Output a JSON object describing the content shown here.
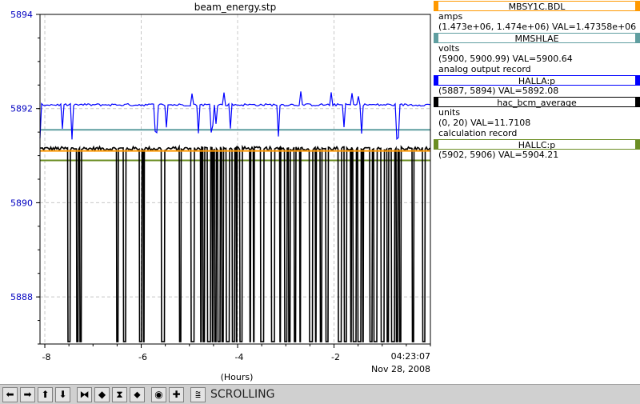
{
  "chart_data": {
    "type": "line",
    "title": "beam_energy.stp",
    "xlabel": "(Hours)",
    "x_ticks": [
      "-8",
      "-6",
      "-4",
      "-2"
    ],
    "y_ticks": [
      "5894",
      "5892",
      "5890",
      "5888"
    ],
    "end_time": "04:23:07",
    "end_date": "Nov 28, 2008",
    "xlim": [
      -8.1,
      0
    ],
    "ylim": [
      5887,
      5894
    ],
    "grid": true,
    "series": [
      {
        "name": "MBSY1C.BDL",
        "color": "#ff9900",
        "shape": "flat",
        "value": 5891.1
      },
      {
        "name": "MMSHLAE",
        "color": "#5f9ea0",
        "shape": "flat",
        "value": 5891.55
      },
      {
        "name": "HALLA:p",
        "color": "#0000ff",
        "shape": "noisy_with_downward_spikes",
        "value": 5892.08
      },
      {
        "name": "hac_bcm_average",
        "color": "#000000",
        "shape": "frequent_drops_to_bottom",
        "value": 5891.15
      },
      {
        "name": "HALLC:p",
        "color": "#6b8e23",
        "shape": "flat",
        "value": 5890.9
      }
    ]
  },
  "legend": [
    {
      "name": "MBSY1C.BDL",
      "color": "#ff9900",
      "lines": [
        "amps",
        "(1.473e+06, 1.474e+06)  VAL=1.47358e+06"
      ]
    },
    {
      "name": "MMSHLAE",
      "color": "#5f9ea0",
      "lines": [
        "volts",
        "(5900, 5900.99)  VAL=5900.64",
        "analog output record"
      ]
    },
    {
      "name": "HALLA:p",
      "color": "#0000ff",
      "lines": [
        "(5887, 5894) VAL=5892.08"
      ]
    },
    {
      "name": "hac_bcm_average",
      "color": "#000000",
      "lines": [
        "units",
        "(0, 20) VAL=11.7108",
        "calculation record"
      ]
    },
    {
      "name": "HALLC:p",
      "color": "#6b8e23",
      "lines": [
        "(5902, 5906)  VAL=5904.21"
      ]
    }
  ],
  "toolbar": {
    "buttons": [
      {
        "name": "scroll-left-button",
        "icon": "arrow-left-icon",
        "glyph": "⬅"
      },
      {
        "name": "scroll-right-button",
        "icon": "arrow-right-icon",
        "glyph": "➡"
      },
      {
        "name": "scroll-up-button",
        "icon": "arrow-up-icon",
        "glyph": "⬆"
      },
      {
        "name": "scroll-down-button",
        "icon": "arrow-down-icon",
        "glyph": "⬇"
      },
      {
        "name": "zoom-in-x-button",
        "icon": "zoom-in-x-icon",
        "glyph": "⧓"
      },
      {
        "name": "zoom-out-x-button",
        "icon": "zoom-out-x-icon",
        "glyph": "◆"
      },
      {
        "name": "zoom-in-y-button",
        "icon": "zoom-in-y-icon",
        "glyph": "⧗"
      },
      {
        "name": "zoom-out-y-button",
        "icon": "zoom-out-y-icon",
        "glyph": "⬥"
      },
      {
        "name": "record-button",
        "icon": "target-icon",
        "glyph": "◉"
      },
      {
        "name": "add-button",
        "icon": "plus-icon",
        "glyph": "✚"
      },
      {
        "name": "scroll-mode-button",
        "icon": "scroll-mode-icon",
        "glyph": "⩰"
      }
    ],
    "status": "SCROLLING"
  }
}
